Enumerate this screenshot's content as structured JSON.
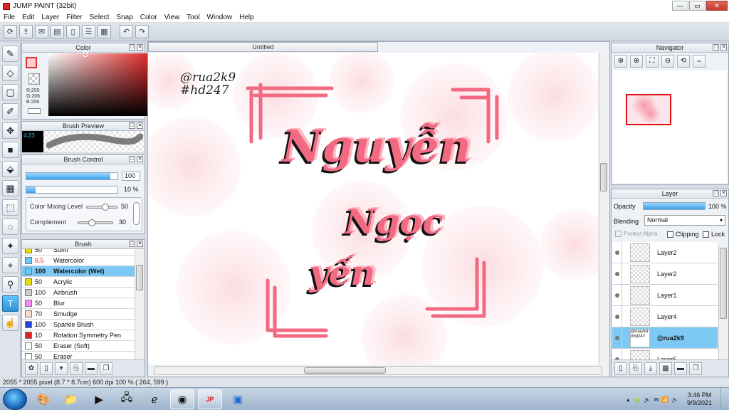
{
  "window": {
    "title": "JUMP PAINT (32bit)",
    "btn_min": "—",
    "btn_max": "▭",
    "btn_close": "✕"
  },
  "menu": [
    "File",
    "Edit",
    "Layer",
    "Filter",
    "Select",
    "Snap",
    "Color",
    "View",
    "Tool",
    "Window",
    "Help"
  ],
  "toolbar": {
    "icons": [
      "sync-icon",
      "share-icon",
      "comment-icon",
      "info-icon",
      "page-icon",
      "list-icon",
      "grid-icon"
    ],
    "undo": "↶",
    "redo": "↷"
  },
  "tools": [
    {
      "name": "brush-tool-icon",
      "glyph": "✎"
    },
    {
      "name": "eraser-tool-icon",
      "glyph": "◇"
    },
    {
      "name": "rectangle-tool-icon",
      "glyph": "▢"
    },
    {
      "name": "pen-tool-icon",
      "glyph": "✐"
    },
    {
      "name": "move-tool-icon",
      "glyph": "✥"
    },
    {
      "name": "fill-rect-tool-icon",
      "glyph": "■"
    },
    {
      "name": "bucket-tool-icon",
      "glyph": "⬙"
    },
    {
      "name": "gradient-tool-icon",
      "glyph": "▦"
    },
    {
      "name": "select-rect-tool-icon",
      "glyph": "⬚"
    },
    {
      "name": "lasso-tool-icon",
      "glyph": "◌"
    },
    {
      "name": "magic-wand-tool-icon",
      "glyph": "✦"
    },
    {
      "name": "picker-tool-icon",
      "glyph": "⌖"
    },
    {
      "name": "dropper-tool-icon",
      "glyph": "⚲"
    },
    {
      "name": "text-tool-icon",
      "glyph": "T"
    },
    {
      "name": "hand-tool-icon",
      "glyph": "☝"
    }
  ],
  "color_panel": {
    "title": "Color",
    "r": "R:255",
    "g": "G:206",
    "b": "B:206",
    "accent": "#e31f1f"
  },
  "brush_preview": {
    "title": "Brush Preview",
    "size": "4.23"
  },
  "brush_control": {
    "title": "Brush Control",
    "size_value": "100",
    "size_fraction": 0.92,
    "opacity_value": "10 %",
    "opacity_fraction": 0.1,
    "mix_label": "Color Mixing Level",
    "mix_value": "50",
    "complement_label": "Complement",
    "complement_value": "30"
  },
  "brush_panel": {
    "title": "Brush",
    "items": [
      {
        "size": "50",
        "name": "Sumi",
        "color": "#e8e000",
        "sel": false
      },
      {
        "size": "6.5",
        "name": "Watercolor",
        "color": "#66ccff",
        "sel": false,
        "red": true
      },
      {
        "size": "100",
        "name": "Watercolor (Wet)",
        "color": "#66ccff",
        "sel": true
      },
      {
        "size": "50",
        "name": "Acrylic",
        "color": "#e8e000",
        "sel": false
      },
      {
        "size": "100",
        "name": "Airbrush",
        "color": "#cccccc",
        "sel": false
      },
      {
        "size": "50",
        "name": "Blur",
        "color": "#ff88ff",
        "sel": false
      },
      {
        "size": "70",
        "name": "Smudge",
        "color": "#ffd9c8",
        "sel": false
      },
      {
        "size": "100",
        "name": "Sparkle Brush",
        "color": "#2244dd",
        "sel": false
      },
      {
        "size": "10",
        "name": "Rotation Symmetry Pen",
        "color": "#dd2222",
        "sel": false
      },
      {
        "size": "50",
        "name": "Eraser (Soft)",
        "color": "#ffffff",
        "sel": false
      },
      {
        "size": "50",
        "name": "Eraser",
        "color": "#ffffff",
        "sel": false
      }
    ]
  },
  "canvas": {
    "tab": "Untitled",
    "handle1": "@rua2k9",
    "handle2": "#hd247",
    "word1": "Nguyễn",
    "word2": "Ngọc",
    "word3": "yến",
    "accent": "#f26a82"
  },
  "navigator": {
    "title": "Navigator",
    "icons": [
      "zoom-fit-icon",
      "zoom-in-icon",
      "zoom-actual-icon",
      "zoom-out-icon",
      "rotate-icon",
      "flip-icon"
    ]
  },
  "layer_panel": {
    "title": "Layer",
    "opacity_label": "Opacity",
    "opacity_value": "100 %",
    "opacity_fraction": 1.0,
    "blending_label": "Blending",
    "blending_value": "Normal",
    "protect_alpha": "Protect Alpha",
    "clipping": "Clipping",
    "lock": "Lock",
    "layers": [
      {
        "name": "Layer2",
        "sel": false,
        "bold": false
      },
      {
        "name": "Layer2",
        "sel": false,
        "bold": false
      },
      {
        "name": "Layer1",
        "sel": false,
        "bold": false
      },
      {
        "name": "Layer4",
        "sel": false,
        "bold": false
      },
      {
        "name": "@rua2k9",
        "sel": true,
        "bold": true,
        "thumbtext": "@rua2k9 #hd247"
      },
      {
        "name": "Layer5",
        "sel": false,
        "bold": false
      }
    ]
  },
  "status": {
    "text": "2055 * 2055 pixel   (8.7 * 8.7cm)   600 dpi   100 %   ( 264, 599 )"
  },
  "taskbar": {
    "time": "3:46 PM",
    "date": "9/9/2021"
  }
}
